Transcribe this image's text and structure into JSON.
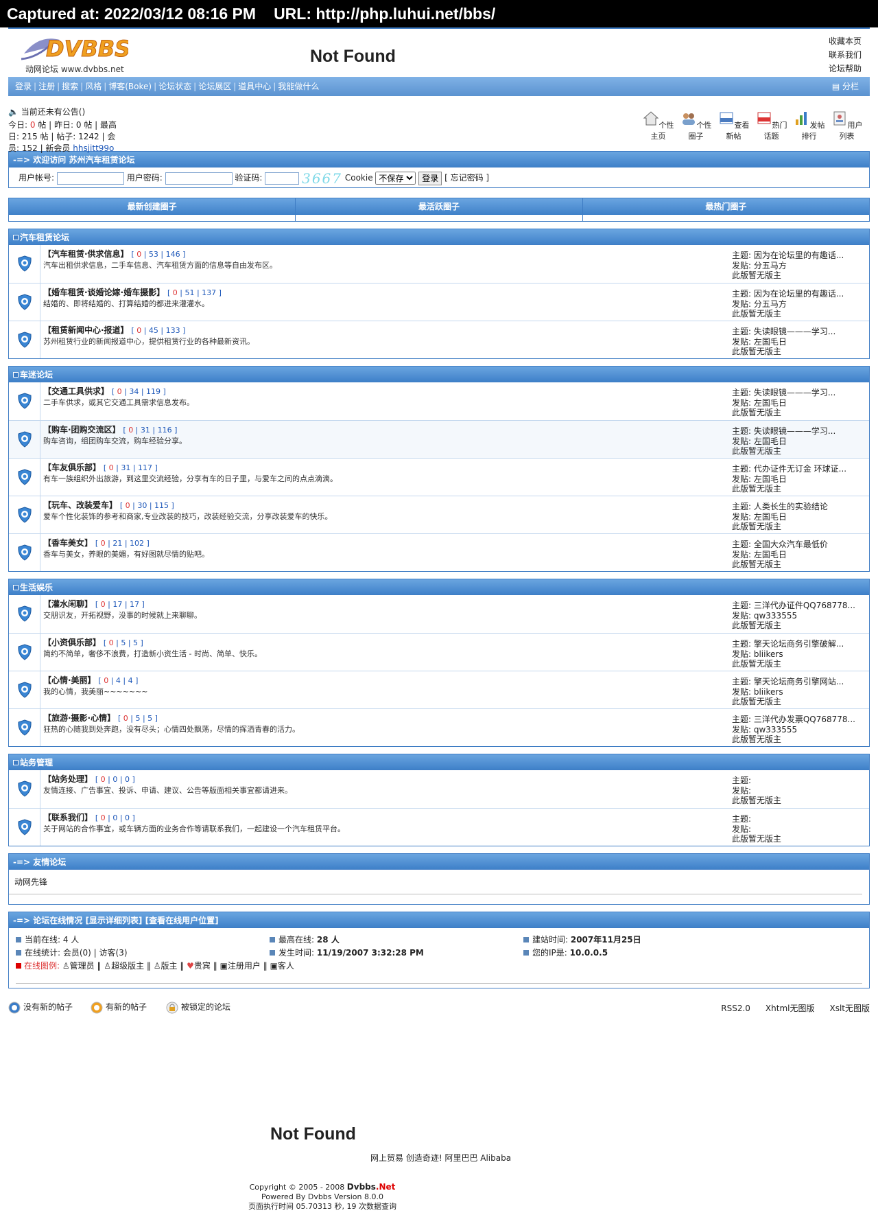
{
  "capture": {
    "captured_at": "Captured at: 2022/03/12 08:16 PM",
    "url": "URL: http://php.luhui.net/bbs/"
  },
  "header": {
    "logo_text": "DVBBS",
    "logo_sub": "动网论坛 www.dvbbs.net",
    "not_found": "Not Found",
    "toplinks": [
      "收藏本页",
      "联系我们",
      "论坛帮助"
    ]
  },
  "nav": {
    "items": [
      "登录",
      "注册",
      "搜索",
      "风格",
      "博客(Boke)",
      "论坛状态",
      "论坛展区",
      "道具中心",
      "我能做什么"
    ],
    "fen": "分栏"
  },
  "info": {
    "notice": "当前还未有公告()",
    "today_label": "今日:",
    "today": "0",
    "yesterday_label": "帖 | 昨日:",
    "yesterday": "0",
    "high_label": "帖 | 最高",
    "line2": "日: 215 帖 | 帖子: 1242 | 会",
    "line3_prefix": "员: 152 | 新会员 ",
    "newest": "hhsjitt99o"
  },
  "icons": [
    "个性主页",
    "个性圈子",
    "查看新帖",
    "热门话题",
    "发帖排行",
    "用户列表"
  ],
  "welcome": {
    "title": "-=> 欢迎访问 苏州汽车租赁论坛",
    "user_label": "用户帐号:",
    "pass_label": "用户密码:",
    "code_label": "验证码:",
    "captcha": "3667",
    "cookie_label": "Cookie",
    "cookie_value": "不保存",
    "login_btn": "登录",
    "forgot": "[ 忘记密码 ]"
  },
  "circles": [
    "最新创建圈子",
    "最活跃圈子",
    "最热门圈子"
  ],
  "categories": [
    {
      "name": "汽车租赁论坛",
      "forums": [
        {
          "title": "【汽车租赁·供求信息】",
          "c": [
            "0",
            "53",
            "146"
          ],
          "desc": "汽车出租供求信息，二手车信息、汽车租赁方面的信息等自由发布区。",
          "topic": "主题: 因为在论坛里的有趣话...",
          "poster": "发贴: 分五马方",
          "mod": "此版暂无版主"
        },
        {
          "title": "【婚车租赁·谈婚论嫁·婚车摄影】",
          "c": [
            "0",
            "51",
            "137"
          ],
          "desc": "结婚的、即将结婚的、打算结婚的都进来灌灌水。",
          "topic": "主题: 因为在论坛里的有趣话...",
          "poster": "发贴: 分五马方",
          "mod": "此版暂无版主"
        },
        {
          "title": "【租赁新闻中心·报道】",
          "c": [
            "0",
            "45",
            "133"
          ],
          "desc": "苏州租赁行业的新闻报道中心，提供租赁行业的各种最新资讯。",
          "topic": "主题: 失读眼镜———学习...",
          "poster": "发贴: 左国毛日",
          "mod": "此版暂无版主"
        }
      ]
    },
    {
      "name": "车迷论坛",
      "forums": [
        {
          "title": "【交通工具供求】",
          "c": [
            "0",
            "34",
            "119"
          ],
          "desc": "二手车供求，或其它交通工具需求信息发布。",
          "topic": "主题: 失读眼镜———学习...",
          "poster": "发贴: 左国毛日",
          "mod": "此版暂无版主"
        },
        {
          "title": "【购车·团购交流区】",
          "c": [
            "0",
            "31",
            "116"
          ],
          "desc": "购车咨询，组团购车交流，购车经验分享。",
          "topic": "主题: 失读眼镜———学习...",
          "poster": "发贴: 左国毛日",
          "mod": "此版暂无版主"
        },
        {
          "title": "【车友俱乐部】",
          "c": [
            "0",
            "31",
            "117"
          ],
          "desc": "有车一族组织外出旅游，到这里交流经验，分享有车的日子里，与爱车之间的点点滴滴。",
          "topic": "主题: 代办证件无订金 环球证...",
          "poster": "发贴: 左国毛日",
          "mod": "此版暂无版主"
        },
        {
          "title": "【玩车、改装爱车】",
          "c": [
            "0",
            "30",
            "115"
          ],
          "desc": "爱车个性化装饰的参考和商家,专业改装的技巧，改装经验交流，分享改装爱车的快乐。",
          "topic": "主题: 人类长生的实验结论",
          "poster": "发贴: 左国毛日",
          "mod": "此版暂无版主"
        },
        {
          "title": "【香车美女】",
          "c": [
            "0",
            "21",
            "102"
          ],
          "desc": "香车与美女，养眼的美媚，有好图就尽情的贴吧。",
          "topic": "主题: 全国大众汽车最低价",
          "poster": "发贴: 左国毛日",
          "mod": "此版暂无版主"
        }
      ]
    },
    {
      "name": "生活娱乐",
      "forums": [
        {
          "title": "【灌水闲聊】",
          "c": [
            "0",
            "17",
            "17"
          ],
          "desc": "交朋识友，开拓视野，没事的时候就上来聊聊。",
          "topic": "主题: 三洋代办证件QQ768778...",
          "poster": "发贴: qw333555",
          "mod": "此版暂无版主"
        },
        {
          "title": "【小资俱乐部】",
          "c": [
            "0",
            "5",
            "5"
          ],
          "desc": "简约不简单，奢侈不浪费，打造新小资生活 - 时尚、简单、快乐。",
          "topic": "主题: 擎天论坛商务引擎破解...",
          "poster": "发贴: bliikers",
          "mod": "此版暂无版主"
        },
        {
          "title": "【心情·美丽】",
          "c": [
            "0",
            "4",
            "4"
          ],
          "desc": "我的心情，我美丽~~~~~~~",
          "topic": "主题: 擎天论坛商务引擎网站...",
          "poster": "发贴: bliikers",
          "mod": "此版暂无版主"
        },
        {
          "title": "【旅游·摄影·心情】",
          "c": [
            "0",
            "5",
            "5"
          ],
          "desc": "狂热的心随我到处奔跑，没有尽头；心情四处飘荡，尽情的挥洒青春的活力。",
          "topic": "主题: 三洋代办发票QQ768778...",
          "poster": "发贴: qw333555",
          "mod": "此版暂无版主"
        }
      ]
    },
    {
      "name": "站务管理",
      "forums": [
        {
          "title": "【站务处理】",
          "c": [
            "0",
            "0",
            "0"
          ],
          "desc": "友情连接、广告事宜、投诉、申请、建议、公告等版面相关事宜都请进来。",
          "topic": "主题:",
          "poster": "发贴:",
          "mod": "此版暂无版主"
        },
        {
          "title": "【联系我们】",
          "c": [
            "0",
            "0",
            "0"
          ],
          "desc": "关于网站的合作事宜，或车辆方面的业务合作等请联系我们，一起建设一个汽车租赁平台。",
          "topic": "主题:",
          "poster": "发贴:",
          "mod": "此版暂无版主"
        }
      ]
    }
  ],
  "friends": {
    "title": "-=> 友情论坛",
    "link": "动网先锋"
  },
  "online": {
    "title": "-=> 论坛在线情况 [显示详细列表] [查看在线用户位置]",
    "c1a": "当前在线: 4 人",
    "c1b": "在线统计: 会员(0) | 访客(3)",
    "c2a_label": "最高在线: ",
    "c2a": "28 人",
    "c2b_label": "发生时间: ",
    "c2b": "11/19/2007 3:32:28 PM",
    "c3a_label": "建站时间: ",
    "c3a": "2007年11月25日",
    "c3b_label": "您的IP是: ",
    "c3b": "10.0.0.5",
    "legend_label": "在线图例:",
    "legend": [
      "管理员",
      "超级版主",
      "版主",
      "贵宾",
      "注册用户",
      "客人"
    ]
  },
  "footer": {
    "legend": [
      "没有新的帖子",
      "有新的帖子",
      "被锁定的论坛"
    ],
    "rss": [
      "RSS2.0",
      "Xhtml无图版",
      "Xslt无图版"
    ],
    "not_found": "Not Found",
    "ad": "网上贸易 创造奇迹! 阿里巴巴 Alibaba",
    "copy1": "Copyright © 2005 - 2008 ",
    "copy_brand": "Dvbbs",
    "copy_net": ".Net",
    "copy2": "Powered By Dvbbs Version 8.0.0",
    "copy3": "页面执行时间 05.70313 秒, 19 次数据查询"
  },
  "colors": {
    "accent": "#3e7cc4",
    "bar_top": "#6aa5e0",
    "red": "#dd3333"
  }
}
